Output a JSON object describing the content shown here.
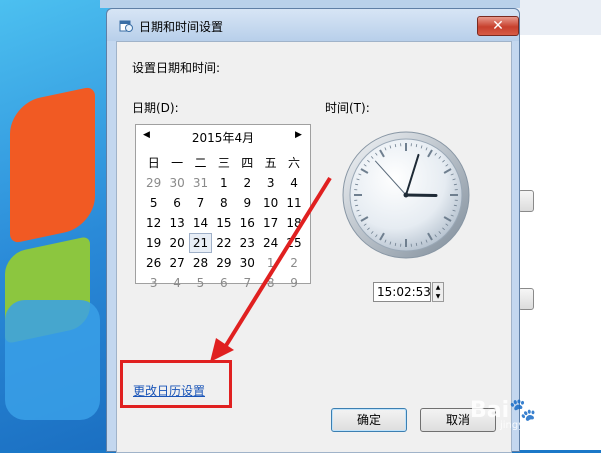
{
  "dialog": {
    "title": "日期和时间设置",
    "close_label": "✕",
    "instruction": "设置日期和时间:",
    "date_label": "日期(D):",
    "time_label": "时间(T):",
    "change_calendar_link": "更改日历设置",
    "ok_label": "确定",
    "cancel_label": "取消"
  },
  "calendar": {
    "month_title": "2015年4月",
    "prev": "◀",
    "next": "▶",
    "weekdays": [
      "日",
      "一",
      "二",
      "三",
      "四",
      "五",
      "六"
    ],
    "weeks": [
      [
        {
          "d": "29",
          "o": true
        },
        {
          "d": "30",
          "o": true
        },
        {
          "d": "31",
          "o": true
        },
        {
          "d": "1"
        },
        {
          "d": "2"
        },
        {
          "d": "3"
        },
        {
          "d": "4"
        }
      ],
      [
        {
          "d": "5"
        },
        {
          "d": "6"
        },
        {
          "d": "7"
        },
        {
          "d": "8"
        },
        {
          "d": "9"
        },
        {
          "d": "10"
        },
        {
          "d": "11"
        }
      ],
      [
        {
          "d": "12"
        },
        {
          "d": "13"
        },
        {
          "d": "14"
        },
        {
          "d": "15"
        },
        {
          "d": "16"
        },
        {
          "d": "17"
        },
        {
          "d": "18"
        }
      ],
      [
        {
          "d": "19"
        },
        {
          "d": "20"
        },
        {
          "d": "21",
          "today": true
        },
        {
          "d": "22"
        },
        {
          "d": "23"
        },
        {
          "d": "24"
        },
        {
          "d": "25"
        }
      ],
      [
        {
          "d": "26"
        },
        {
          "d": "27"
        },
        {
          "d": "28"
        },
        {
          "d": "29"
        },
        {
          "d": "30"
        },
        {
          "d": "1",
          "o": true
        },
        {
          "d": "2",
          "o": true
        }
      ],
      [
        {
          "d": "3",
          "o": true
        },
        {
          "d": "4",
          "o": true
        },
        {
          "d": "5",
          "o": true
        },
        {
          "d": "6",
          "o": true
        },
        {
          "d": "7",
          "o": true
        },
        {
          "d": "8",
          "o": true
        },
        {
          "d": "9",
          "o": true
        }
      ]
    ]
  },
  "clock": {
    "hour": 15,
    "minute": 2,
    "second": 53
  },
  "time": {
    "value": "15:02:53",
    "spin_up": "▲",
    "spin_down": "▼"
  },
  "watermark": {
    "text": "Bai🐾经验",
    "sub": "jingyan.baidu.com"
  },
  "colors": {
    "annotation": "#e02020",
    "link": "#1a55b8"
  }
}
